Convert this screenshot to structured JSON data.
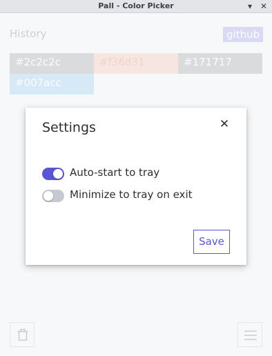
{
  "window": {
    "title": "Pall - Color Picker",
    "minimize_glyph": "▾",
    "close_glyph": "✕"
  },
  "header": {
    "history_label": "History",
    "github_label": "github"
  },
  "history": [
    {
      "hex": "#2c2c2c",
      "bg": "#c4c4c4",
      "fg": "#ffffff"
    },
    {
      "hex": "#f36d31",
      "bg": "#f6d6cc",
      "fg": "#f0b6a3"
    },
    {
      "hex": "#171717",
      "bg": "#c4c4c4",
      "fg": "#ffffff"
    },
    {
      "hex": "#007acc",
      "bg": "#bcdcf2",
      "fg": "#ffffff"
    }
  ],
  "dialog": {
    "title": "Settings",
    "close_glyph": "✕",
    "settings": [
      {
        "label": "Auto-start to tray",
        "enabled": true
      },
      {
        "label": "Minimize to tray on exit",
        "enabled": false
      }
    ],
    "save_label": "Save"
  },
  "toolbar": {
    "trash_icon": "trash-icon",
    "menu_icon": "menu-icon"
  },
  "colors": {
    "accent": "#5a55d2",
    "github_bg": "#c2c0ef"
  }
}
